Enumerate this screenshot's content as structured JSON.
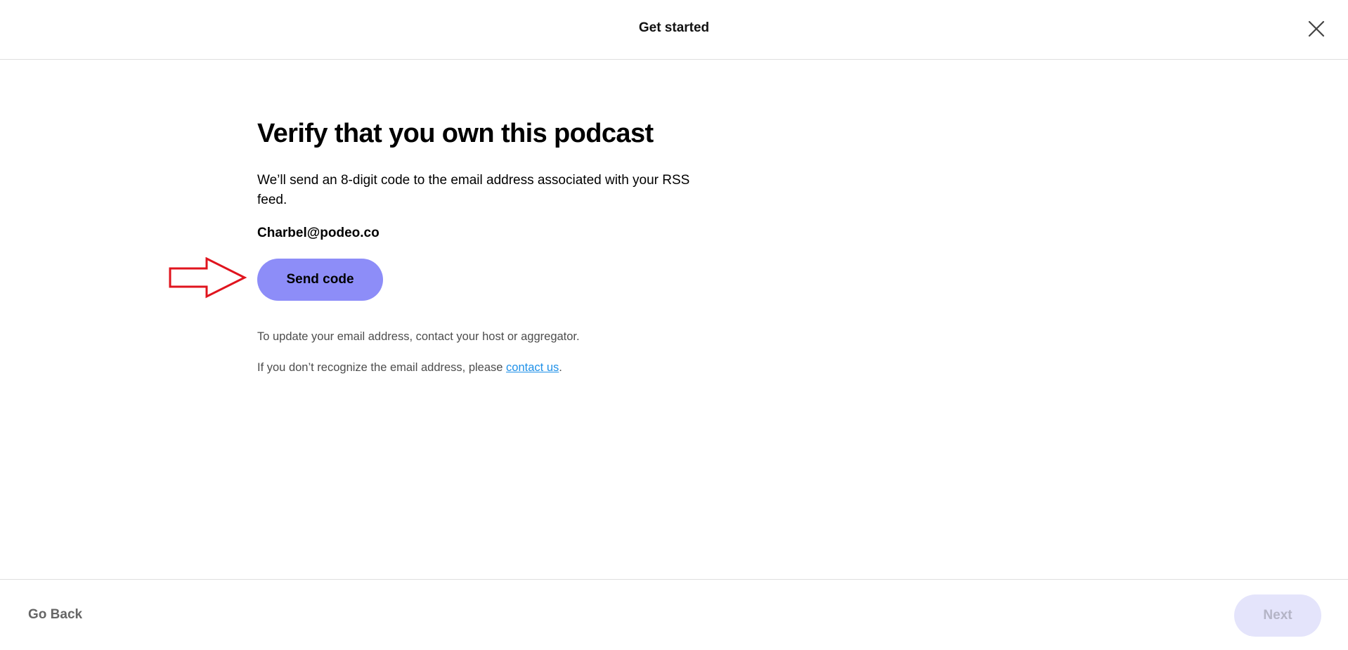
{
  "header": {
    "title": "Get started",
    "close_icon": "close-icon"
  },
  "main": {
    "heading": "Verify that you own this podcast",
    "description": "We’ll send an 8-digit code to the email address associated with your RSS feed.",
    "email": "Charbel@podeo.co",
    "send_code_label": "Send code",
    "note_update": "To update your email address, contact your host or aggregator.",
    "note_recognize_prefix": "If you don’t recognize the email address, please ",
    "note_recognize_link": "contact us",
    "note_recognize_suffix": "."
  },
  "annotation": {
    "arrow_icon": "arrow-right-icon",
    "color": "#e0141e"
  },
  "footer": {
    "go_back_label": "Go Back",
    "next_label": "Next",
    "next_disabled": true
  },
  "colors": {
    "primary_button": "#8d8df8",
    "disabled_button": "#e4e4fb",
    "link": "#1e90e8"
  }
}
